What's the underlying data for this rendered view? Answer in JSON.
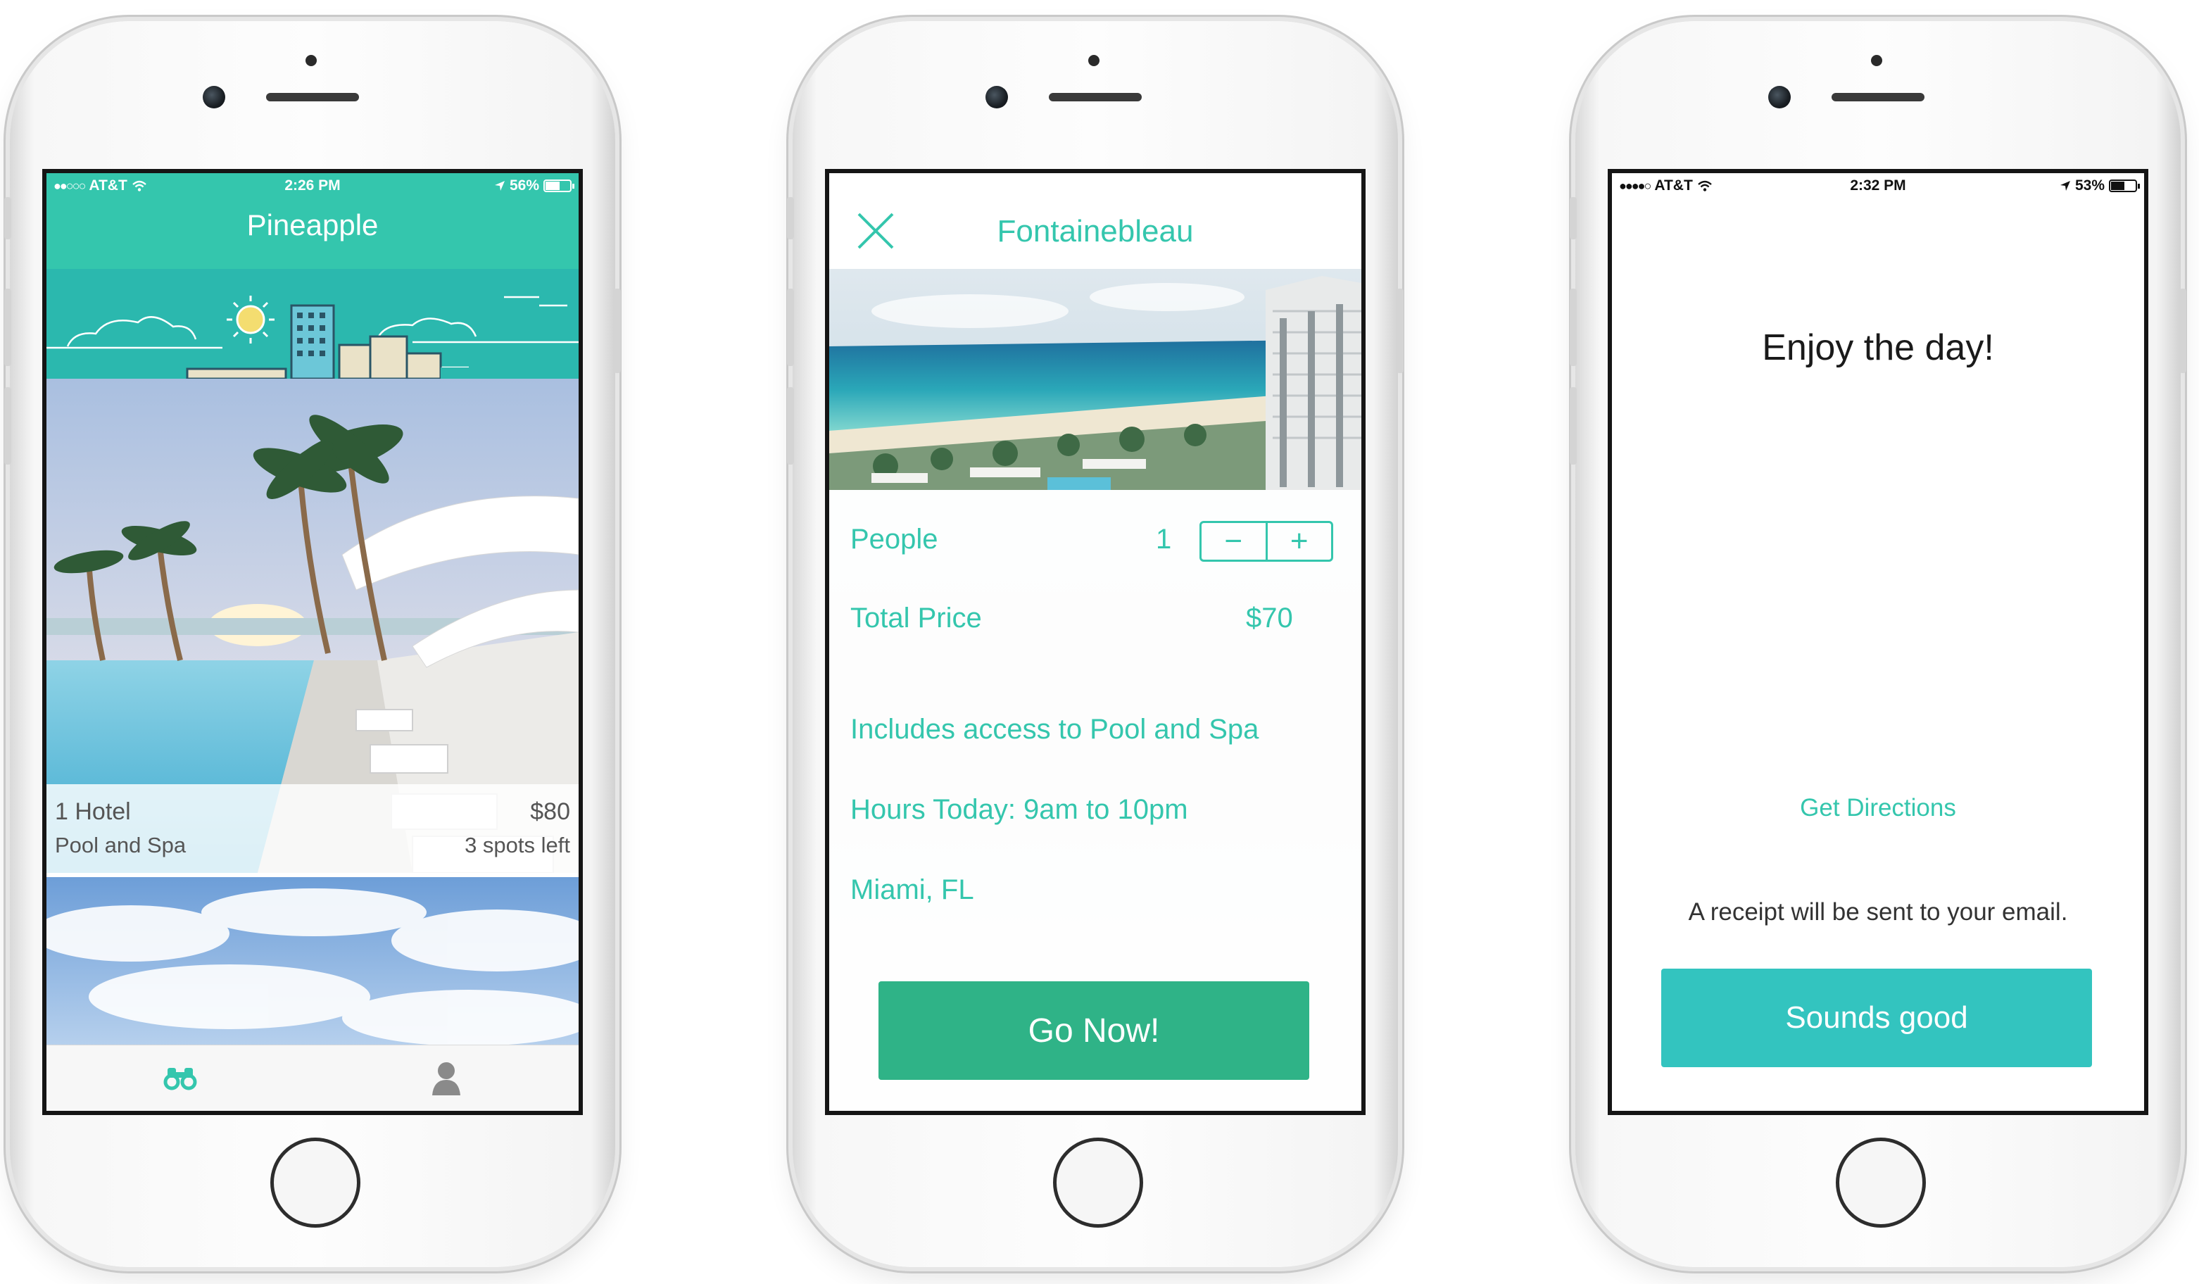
{
  "phones": [
    {
      "status": {
        "carrier": "AT&T",
        "time": "2:26 PM",
        "battery": "56%",
        "battery_level": 0.56
      },
      "header": {
        "title": "Pineapple"
      },
      "listing": {
        "name": "1 Hotel",
        "price": "$80",
        "category": "Pool and Spa",
        "availability": "3 spots left"
      },
      "tabs": [
        {
          "icon": "binoculars-icon",
          "active": true
        },
        {
          "icon": "profile-icon",
          "active": false
        }
      ],
      "colors": {
        "accent": "#34c6ad",
        "banner": "#2bb8ae"
      }
    },
    {
      "header": {
        "title": "Fontainebleau",
        "close_icon": "close-icon"
      },
      "people": {
        "label": "People",
        "value": "1",
        "decrement": "−",
        "increment": "+"
      },
      "total_price": {
        "label": "Total Price",
        "value": "$70"
      },
      "details": [
        "Includes access to Pool and Spa",
        "Hours Today: 9am to 10pm",
        "Miami, FL"
      ],
      "cta": {
        "label": "Go Now!",
        "color": "#2fb387"
      }
    },
    {
      "status": {
        "carrier": "AT&T",
        "time": "2:32 PM",
        "battery": "53%",
        "battery_level": 0.53
      },
      "title": "Enjoy the day!",
      "link": "Get Directions",
      "note": "A receipt will be sent to your email.",
      "cta": {
        "label": "Sounds good",
        "color": "#33c4bf"
      }
    }
  ]
}
